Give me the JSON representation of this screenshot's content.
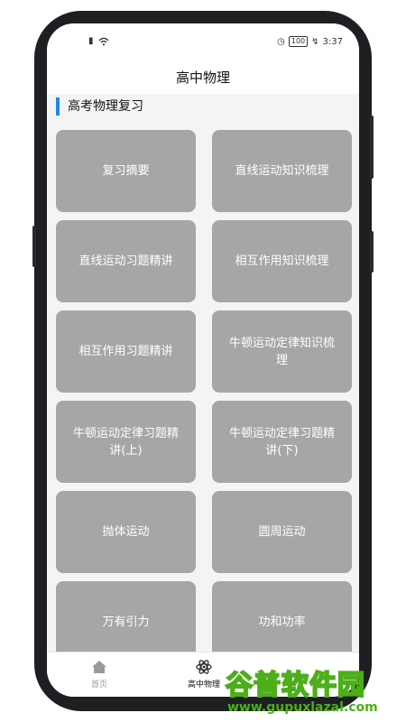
{
  "status": {
    "time": "3:37",
    "battery": "100"
  },
  "header": {
    "title": "高中物理"
  },
  "section": {
    "title": "高考物理复习"
  },
  "cards": [
    "复习摘要",
    "直线运动知识梳理",
    "直线运动习题精讲",
    "相互作用知识梳理",
    "相互作用习题精讲",
    "牛顿运动定律知识梳理",
    "牛顿运动定律习题精讲(上)",
    "牛顿运动定律习题精讲(下)",
    "抛体运动",
    "圆周运动",
    "万有引力",
    "功和功率"
  ],
  "tabs": [
    {
      "label": "首页",
      "icon": "home-icon"
    },
    {
      "label": "高中物理",
      "icon": "atom-icon"
    }
  ],
  "watermark": {
    "brand": "谷普软件园",
    "url": "www.gupuxlazal.com"
  },
  "colors": {
    "accent": "#1e88e5",
    "card": "#a6a6a6",
    "watermark": "#4caf1a"
  }
}
